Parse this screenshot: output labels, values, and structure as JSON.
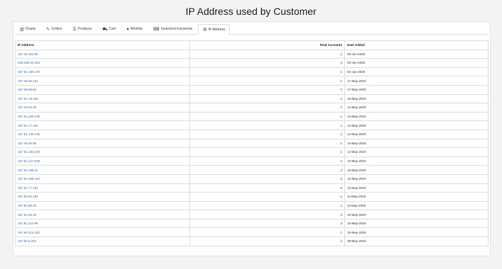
{
  "page": {
    "title": "IP Address used by Customer"
  },
  "tabs": [
    {
      "label": "Charts",
      "icon": "bar-chart-icon",
      "glyph": "▥"
    },
    {
      "label": "Orders",
      "icon": "edit-icon",
      "glyph": "✎"
    },
    {
      "label": "Products",
      "icon": "list-icon",
      "glyph": "☰"
    },
    {
      "label": "Cart",
      "icon": "cart-icon",
      "glyph": "⛟"
    },
    {
      "label": "Wishlist",
      "icon": "heart-icon",
      "glyph": "♥"
    },
    {
      "label": "Searched Keywords",
      "icon": "keyboard-icon",
      "glyph": "⌨"
    },
    {
      "label": "IP Address",
      "icon": "globe-icon",
      "glyph": "◍",
      "active": true
    }
  ],
  "table": {
    "headers": {
      "ip": "IP Address",
      "total": "Total Accounts",
      "date": "Date Added"
    },
    "rows": [
      {
        "ip": "157.46.102.50",
        "total": "1",
        "date": "05-Jun-2020"
      },
      {
        "ip": "106.198.34.164",
        "total": "1",
        "date": "03-Jun-2020"
      },
      {
        "ip": "157.51.189.170",
        "total": "1",
        "date": "02-Jun-2020"
      },
      {
        "ip": "157.46.55.131",
        "total": "1",
        "date": "17-May-2020"
      },
      {
        "ip": "157.46.83.63",
        "total": "1",
        "date": "17-May-2020"
      },
      {
        "ip": "157.51.79.158",
        "total": "1",
        "date": "15-May-2020"
      },
      {
        "ip": "157.46.83.38",
        "total": "1",
        "date": "14-May-2020"
      },
      {
        "ip": "157.51.220.140",
        "total": "1",
        "date": "14-May-2020"
      },
      {
        "ip": "157.51.77.104",
        "total": "1",
        "date": "14-May-2020"
      },
      {
        "ip": "157.51.145.145",
        "total": "1",
        "date": "14-May-2020"
      },
      {
        "ip": "157.46.55.95",
        "total": "1",
        "date": "14-May-2020"
      },
      {
        "ip": "157.51.182.220",
        "total": "1",
        "date": "14-May-2020"
      },
      {
        "ip": "157.51.127.206",
        "total": "1",
        "date": "13-May-2020"
      },
      {
        "ip": "157.51.198.12",
        "total": "2",
        "date": "13-May-2020"
      },
      {
        "ip": "157.51.258.118",
        "total": "5",
        "date": "12-May-2020"
      },
      {
        "ip": "157.51.77.122",
        "total": "5",
        "date": "12-May-2020"
      },
      {
        "ip": "157.50.52.151",
        "total": "1",
        "date": "11-May-2020"
      },
      {
        "ip": "157.51.89.36",
        "total": "1",
        "date": "11-May-2020"
      },
      {
        "ip": "157.51.85.34",
        "total": "2",
        "date": "10-May-2020"
      },
      {
        "ip": "157.51.210.99",
        "total": "2",
        "date": "10-May-2020"
      },
      {
        "ip": "157.50.113.233",
        "total": "1",
        "date": "10-May-2020"
      },
      {
        "ip": "157.50.6.204",
        "total": "1",
        "date": "09-May-2020"
      }
    ]
  }
}
